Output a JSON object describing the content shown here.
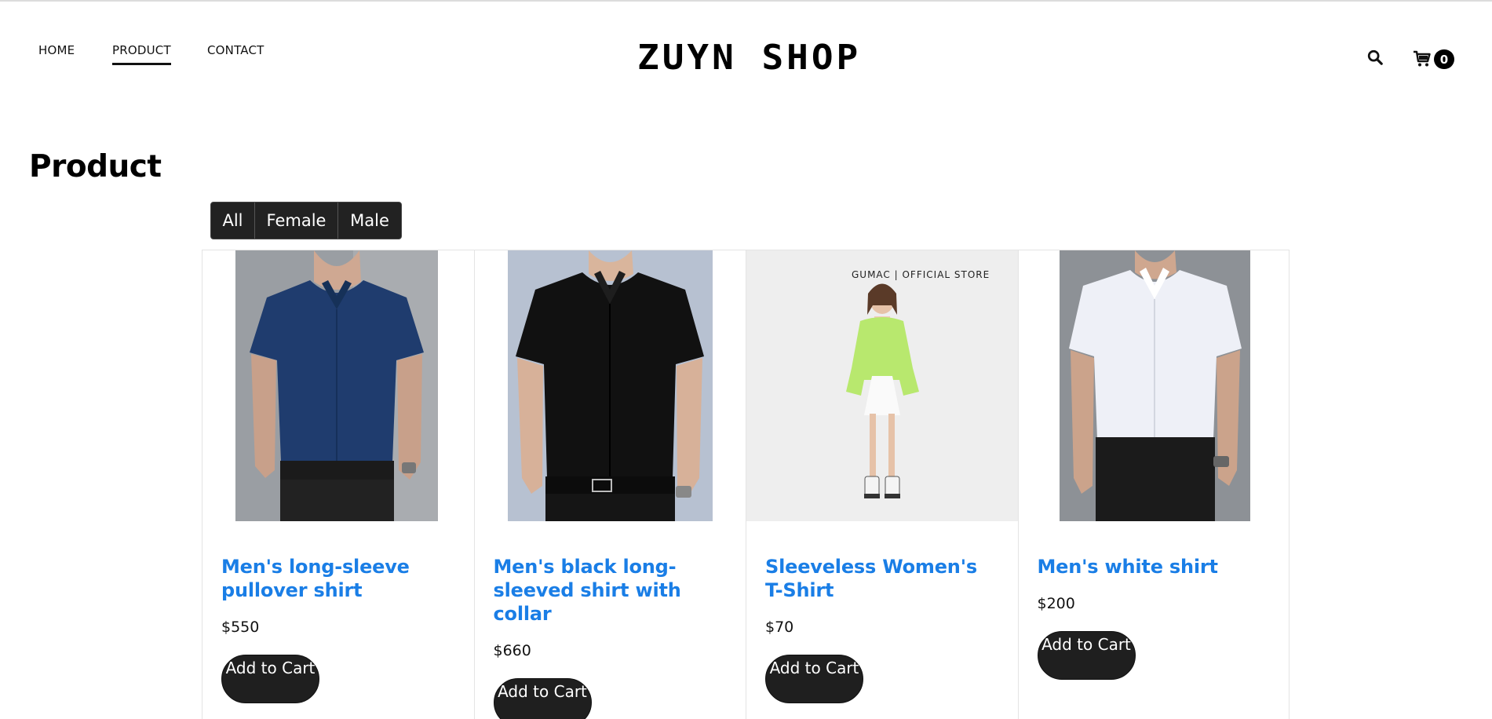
{
  "header": {
    "nav": [
      {
        "label": "HOME"
      },
      {
        "label": "PRODUCT",
        "active": true
      },
      {
        "label": "CONTACT"
      }
    ],
    "logo": "ZUYN SHOP",
    "cart_count": "0",
    "icons": [
      "search-icon",
      "cart-icon"
    ]
  },
  "page": {
    "title": "Product"
  },
  "filters": [
    {
      "label": "All"
    },
    {
      "label": "Female"
    },
    {
      "label": "Male"
    }
  ],
  "products": [
    {
      "name": "Men's long-sleeve pullover shirt",
      "price": "$550",
      "button": "Add to Cart",
      "image": "navy-shirt-model"
    },
    {
      "name": "Men's black long-sleeved shirt with collar",
      "price": "$660",
      "button": "Add to Cart",
      "image": "black-shirt-model"
    },
    {
      "name": "Sleeveless Women's T-Shirt",
      "price": "$70",
      "button": "Add to Cart",
      "image": "woman-green-jacket-model",
      "image_text": "GUMAC | OFFICIAL STORE"
    },
    {
      "name": "Men's white shirt",
      "price": "$200",
      "button": "Add to Cart",
      "image": "white-shirt-model"
    }
  ],
  "colors": {
    "accent_link": "#1a7ee6",
    "button_dark": "#1f1f1f",
    "text": "#111111"
  }
}
